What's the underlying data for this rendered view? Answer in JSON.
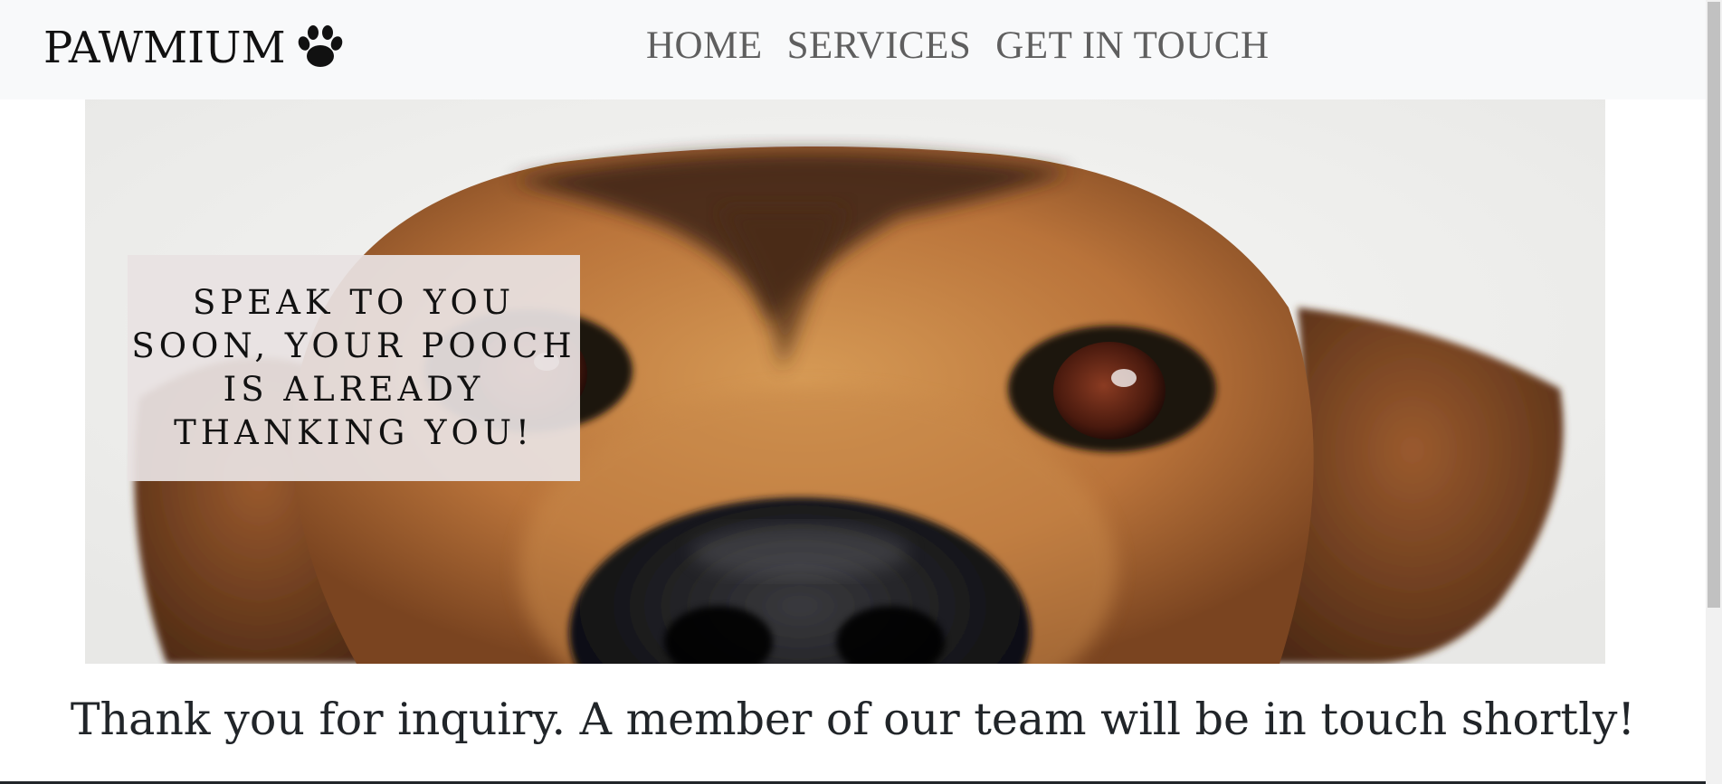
{
  "navbar": {
    "brand": "PAWMIUM",
    "brand_icon": "paw-icon",
    "links": [
      {
        "label": "HOME"
      },
      {
        "label": "SERVICES"
      },
      {
        "label": "GET IN TOUCH"
      }
    ]
  },
  "hero": {
    "image": "dog-face-closeup",
    "caption": "SPEAK TO YOU SOON, YOUR POOCH IS ALREADY THANKING YOU!"
  },
  "main": {
    "thank_you_message": "Thank you for inquiry. A member of our team will be in touch shortly!"
  },
  "colors": {
    "navbar_bg": "#f8f9fa",
    "nav_link": "#5f5f5f",
    "caption_bg": "#e8e2e2",
    "text": "#212529"
  }
}
